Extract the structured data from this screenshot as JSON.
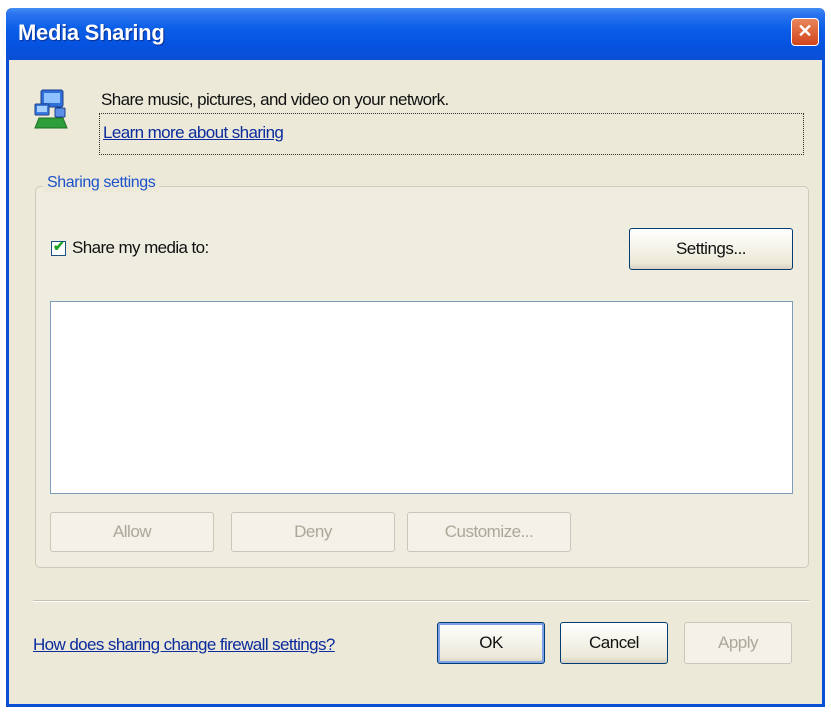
{
  "window": {
    "title": "Media Sharing",
    "close_glyph": "✕"
  },
  "intro": {
    "icon": "media-sharing-network-icon",
    "description": "Share music, pictures, and video on your network.",
    "learn_more_link": "Learn more about sharing"
  },
  "sharing_settings": {
    "group_label": "Sharing settings",
    "share_checkbox_label": "Share my media to:",
    "share_checked": true,
    "settings_button": "Settings...",
    "device_list": [],
    "allow_button": "Allow",
    "deny_button": "Deny",
    "customize_button": "Customize..."
  },
  "footer": {
    "firewall_link": "How does sharing change firewall settings?",
    "ok_button": "OK",
    "cancel_button": "Cancel",
    "apply_button": "Apply"
  },
  "colors": {
    "titlebar": "#0a5ee8",
    "dialog_bg": "#ece9d8",
    "link": "#0b2b9e",
    "group_label": "#1c52c9",
    "close_button": "#d2441b"
  }
}
